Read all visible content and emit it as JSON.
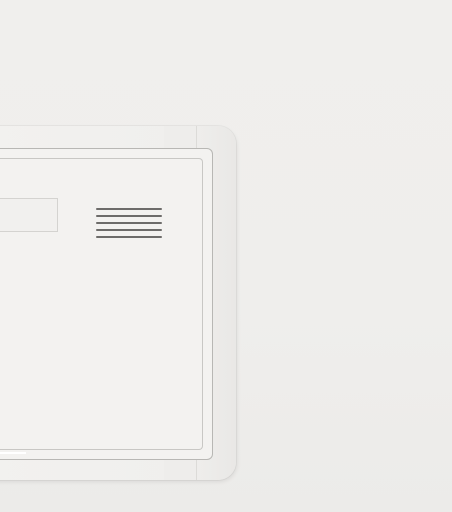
{
  "image": {
    "subject": "white-plastic-panel-cover",
    "colors": {
      "background": "#efeeec",
      "panel": "#f2f1ef",
      "outline": "#b8b7b4",
      "vent": "#6d6c6a"
    },
    "vent": {
      "icon": "vent-slots-icon",
      "slot_count": 5
    }
  }
}
